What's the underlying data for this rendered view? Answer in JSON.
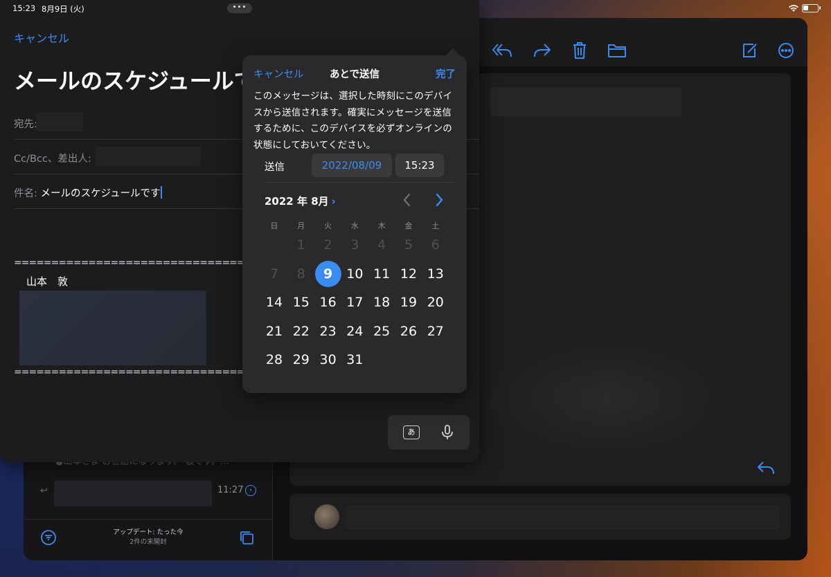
{
  "status_bar": {
    "time": "15:23",
    "date": "8月9日 (火)",
    "multitask": "•••"
  },
  "compose": {
    "cancel": "キャンセル",
    "title": "メールのスケジュールです",
    "to_label": "宛先:",
    "cc_label": "Cc/Bcc、差出人:",
    "subject_label": "件名:",
    "subject_value": "メールのスケジュールです",
    "signature_rule": "==============================================",
    "signature_name": "山本　敦"
  },
  "keyboard": {
    "kana_key": "あ"
  },
  "send_later": {
    "cancel": "キャンセル",
    "title": "あとで送信",
    "done": "完了",
    "description": "このメッセージは、選択した時刻にこのデバイスから送信されます。確実にメッセージを送信するために、このデバイスを必ずオンラインの状態にしておいてください。",
    "send_label": "送信",
    "date_value": "2022/08/09",
    "time_value": "15:23",
    "month_header": "2022 年 8月",
    "month_chevron": "›",
    "weekdays": [
      "日",
      "月",
      "火",
      "水",
      "木",
      "金",
      "土"
    ],
    "weeks": [
      [
        "",
        "1",
        "2",
        "3",
        "4",
        "5",
        "6"
      ],
      [
        "7",
        "8",
        "9",
        "10",
        "11",
        "12",
        "13"
      ],
      [
        "14",
        "15",
        "16",
        "17",
        "18",
        "19",
        "20"
      ],
      [
        "21",
        "22",
        "23",
        "24",
        "25",
        "26",
        "27"
      ],
      [
        "28",
        "29",
        "30",
        "31",
        "",
        "",
        ""
      ]
    ],
    "selected_day": "9",
    "accent_color": "#3b8cf0"
  },
  "mail_list": {
    "preview_text": "●山本さま お世話になります。 敬です。...",
    "row_time": "11:27",
    "footer_status": "アップデート: たった今",
    "footer_sub": "2件の未開封"
  }
}
